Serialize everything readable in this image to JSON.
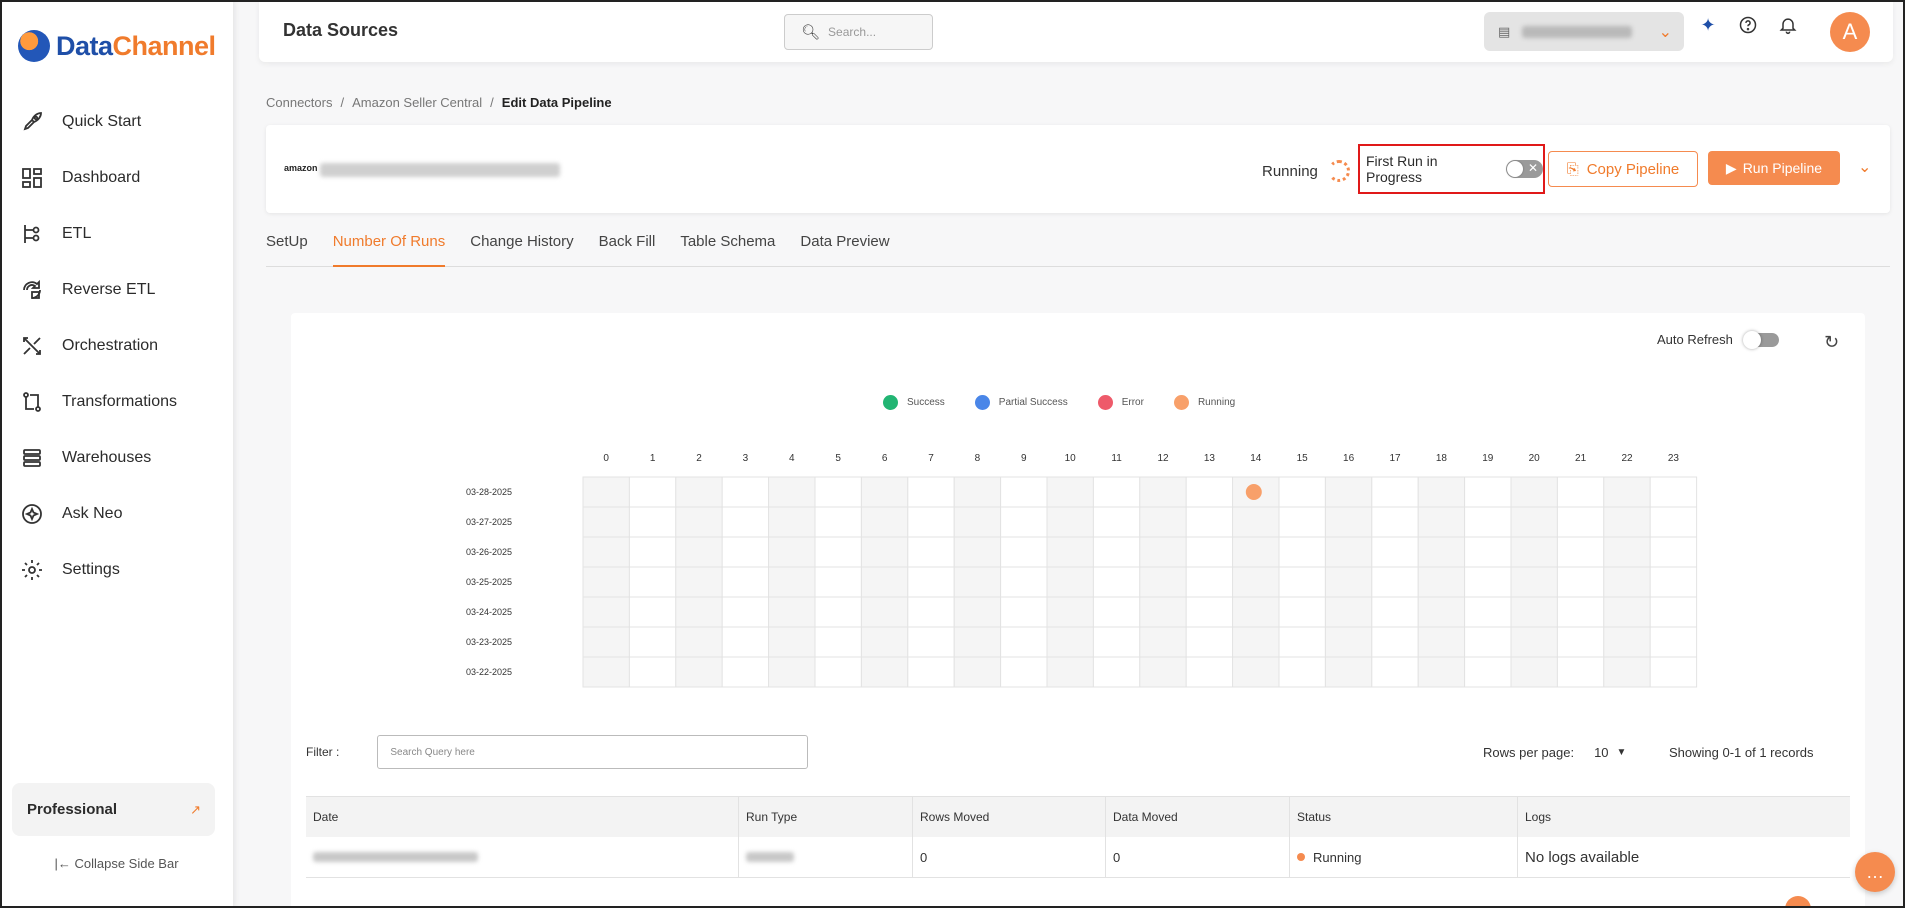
{
  "brand": {
    "part1": "Data",
    "part2": "Channel"
  },
  "sidebar": {
    "items": [
      {
        "label": "Quick Start",
        "icon": "rocket-icon"
      },
      {
        "label": "Dashboard",
        "icon": "dashboard-icon"
      },
      {
        "label": "ETL",
        "icon": "etl-icon"
      },
      {
        "label": "Reverse ETL",
        "icon": "reverse-etl-icon"
      },
      {
        "label": "Orchestration",
        "icon": "orchestration-icon"
      },
      {
        "label": "Transformations",
        "icon": "transformations-icon"
      },
      {
        "label": "Warehouses",
        "icon": "warehouses-icon"
      },
      {
        "label": "Ask Neo",
        "icon": "ask-neo-icon"
      },
      {
        "label": "Settings",
        "icon": "settings-icon"
      }
    ],
    "plan": "Professional",
    "collapse_label": "Collapse Side Bar"
  },
  "topbar": {
    "title": "Data Sources",
    "search_placeholder": "Search...",
    "avatar_initial": "A"
  },
  "breadcrumb": {
    "items": [
      "Connectors",
      "Amazon Seller Central"
    ],
    "current": "Edit Data Pipeline"
  },
  "pipeline": {
    "logo_text": "amazon",
    "status": "Running",
    "first_run_label": "First Run in Progress",
    "copy_label": "Copy Pipeline",
    "run_label": "Run Pipeline"
  },
  "tabs": [
    "SetUp",
    "Number Of Runs",
    "Change History",
    "Back Fill",
    "Table Schema",
    "Data Preview"
  ],
  "active_tab": 1,
  "runs": {
    "auto_refresh_label": "Auto Refresh",
    "legend": [
      {
        "label": "Success",
        "color": "#22b573"
      },
      {
        "label": "Partial Success",
        "color": "#4a86e8"
      },
      {
        "label": "Error",
        "color": "#ee5a6a"
      },
      {
        "label": "Running",
        "color": "#f8a06a"
      }
    ],
    "hours": [
      "0",
      "1",
      "2",
      "3",
      "4",
      "5",
      "6",
      "7",
      "8",
      "9",
      "10",
      "11",
      "12",
      "13",
      "14",
      "15",
      "16",
      "17",
      "18",
      "19",
      "20",
      "21",
      "22",
      "23"
    ],
    "dates": [
      "03-28-2025",
      "03-27-2025",
      "03-26-2025",
      "03-25-2025",
      "03-24-2025",
      "03-23-2025",
      "03-22-2025"
    ],
    "points": [
      {
        "date": "03-28-2025",
        "hour": "14",
        "status": "Running"
      }
    ]
  },
  "table": {
    "filter_label": "Filter :",
    "filter_placeholder": "Search Query here",
    "rows_per_page_label": "Rows per page:",
    "rows_per_page": "10",
    "showing": "Showing 0-1 of 1 records",
    "columns": [
      "Date",
      "Run Type",
      "Rows Moved",
      "Data Moved",
      "Status",
      "Logs"
    ],
    "rows": [
      {
        "rows_moved": "0",
        "data_moved": "0",
        "status": "Running",
        "logs": "No logs available"
      }
    ]
  }
}
